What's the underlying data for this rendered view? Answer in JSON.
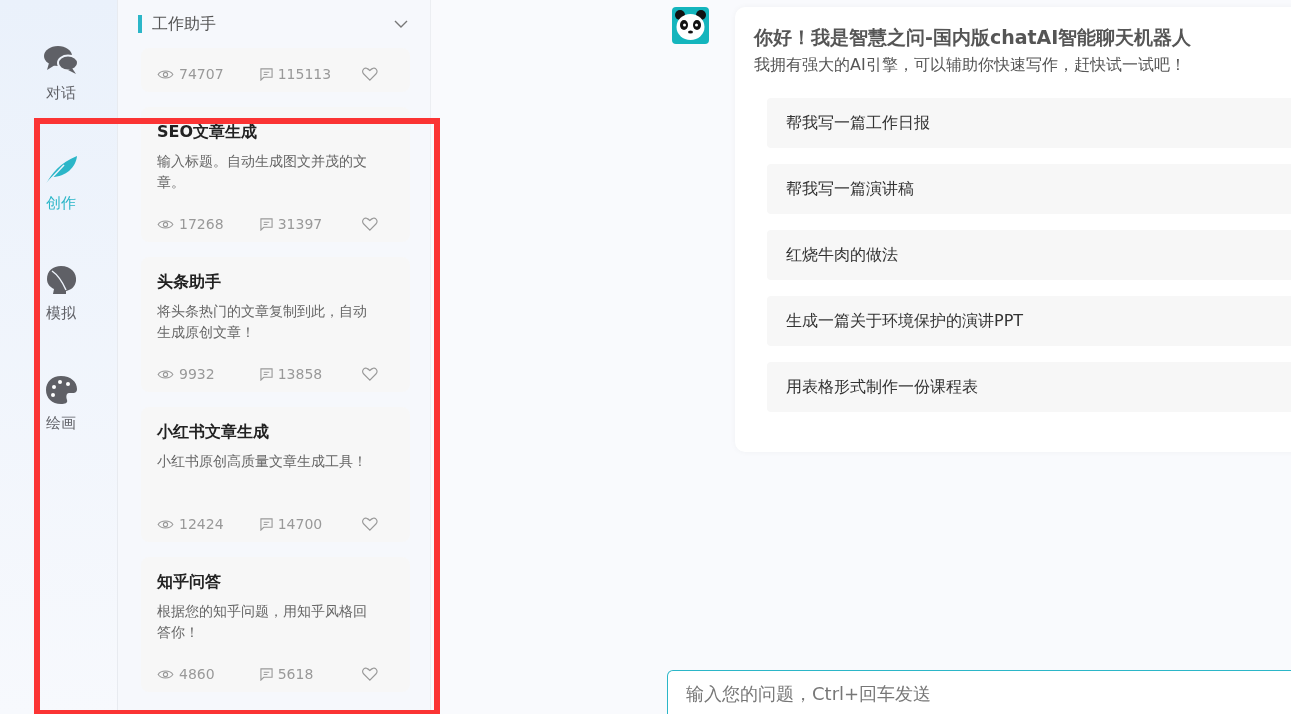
{
  "nav": [
    {
      "label": "对话",
      "kind": "chat",
      "selected": false
    },
    {
      "label": "创作",
      "kind": "feather",
      "selected": true
    },
    {
      "label": "模拟",
      "kind": "head",
      "selected": false
    },
    {
      "label": "绘画",
      "kind": "palette",
      "selected": false
    }
  ],
  "category": {
    "title": "工作助手"
  },
  "cards": [
    {
      "views": "74707",
      "comments": "115113"
    },
    {
      "title": "SEO文章生成",
      "description": "输入标题。自动生成图文并茂的文章。",
      "views": "17268",
      "comments": "31397"
    },
    {
      "title": "头条助手",
      "description": "将头条热门的文章复制到此，自动生成原创文章！",
      "views": "9932",
      "comments": "13858"
    },
    {
      "title": "小红书文章生成",
      "description": "小红书原创高质量文章生成工具！",
      "views": "12424",
      "comments": "14700"
    },
    {
      "title": "知乎问答",
      "description": "根据您的知乎问题，用知乎风格回答你！",
      "views": "4860",
      "comments": "5618"
    }
  ],
  "welcome": {
    "title": "你好！我是智慧之问-国内版chatAI智能聊天机器人",
    "subtitle": "我拥有强大的AI引擎，可以辅助你快速写作，赶快试一试吧！",
    "suggestions": [
      "帮我写一篇工作日报",
      "帮我写一篇演讲稿",
      "红烧牛肉的做法",
      "生成一篇关于环境保护的演讲PPT",
      "用表格形式制作一份课程表"
    ]
  },
  "input": {
    "placeholder": "输入您的问题，Ctrl+回车发送"
  }
}
